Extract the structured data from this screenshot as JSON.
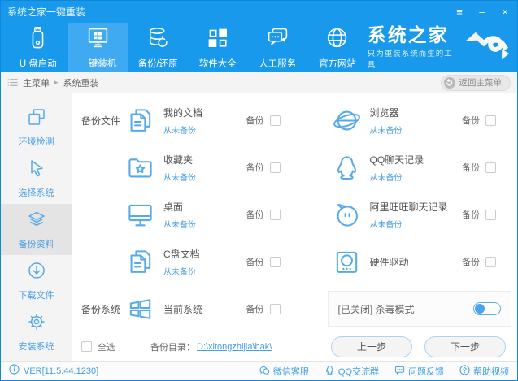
{
  "window": {
    "title": "系统之家一键重装"
  },
  "nav": {
    "tabs": [
      {
        "label": "U 盘启动"
      },
      {
        "label": "一键装机"
      },
      {
        "label": "备份/还原"
      },
      {
        "label": "软件大全"
      },
      {
        "label": "人工服务"
      },
      {
        "label": "官方网站"
      }
    ],
    "brand": {
      "title": "系统之家",
      "tagline": "只为重装系统而生的工具"
    }
  },
  "breadcrumb": {
    "root": "主菜单",
    "sep": "▸",
    "current": "系统重装",
    "back_button": "返回主菜单"
  },
  "sidebar": {
    "items": [
      {
        "label": "环境检测"
      },
      {
        "label": "选择系统"
      },
      {
        "label": "备份资料"
      },
      {
        "label": "下载文件"
      },
      {
        "label": "安装系统"
      }
    ]
  },
  "main": {
    "backup_files_label": "备份文件",
    "backup_system_label": "备份系统",
    "backup_checkbox_label": "备份",
    "files_left": [
      {
        "title": "我的文档",
        "status": "从未备份"
      },
      {
        "title": "收藏夹",
        "status": "从未备份"
      },
      {
        "title": "桌面",
        "status": "从未备份"
      },
      {
        "title": "C盘文档",
        "status": "从未备份"
      }
    ],
    "files_right": [
      {
        "title": "浏览器",
        "status": "从未备份"
      },
      {
        "title": "QQ聊天记录",
        "status": "从未备份"
      },
      {
        "title": "阿里旺旺聊天记录",
        "status": "从未备份"
      },
      {
        "title": "硬件驱动",
        "status": ""
      }
    ],
    "system_row": {
      "title": "当前系统"
    },
    "antivirus": {
      "label": "[已关闭] 杀毒模式",
      "enabled": false
    },
    "select_all_label": "全选",
    "backup_dir_label": "备份目录：",
    "backup_dir_path": "D:\\xitongzhijia\\bak\\",
    "prev_button": "上一步",
    "next_button": "下一步"
  },
  "statusbar": {
    "version": "VER[11.5.44.1230]",
    "links": [
      {
        "label": "微信客服"
      },
      {
        "label": "QQ交流群"
      },
      {
        "label": "问题反馈"
      },
      {
        "label": "帮助视频"
      }
    ]
  },
  "colors": {
    "primary": "#1899ec",
    "active_tab": "#3faaf1",
    "accent_blue": "#57aaea",
    "link_blue": "#3f9fe8"
  }
}
